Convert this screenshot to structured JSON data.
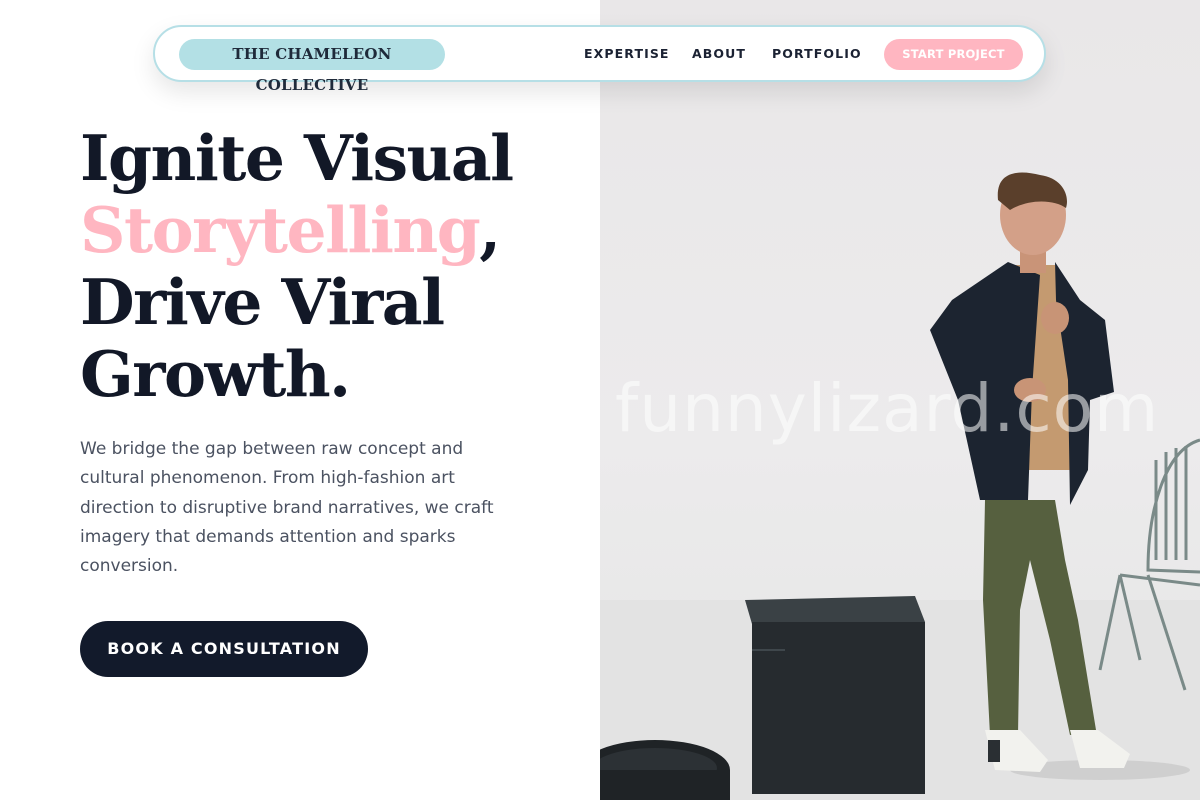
{
  "nav": {
    "brand": "THE CHAMELEON COLLECTIVE",
    "links": [
      "EXPERTISE",
      "ABOUT",
      "PORTFOLIO"
    ],
    "cta": "START PROJECT"
  },
  "hero": {
    "headline_line1": "Ignite Visual",
    "headline_accent": "Storytelling",
    "headline_comma": ",",
    "headline_line3": "Drive Viral",
    "headline_line4": "Growth.",
    "description": "We bridge the gap between raw concept and cultural phenomenon. From high-fashion art direction to disruptive brand narratives, we craft imagery that demands attention and sparks conversion.",
    "cta": "BOOK A CONSULTATION"
  },
  "watermark": "funnylizard.com",
  "colors": {
    "accent_pink": "#ffb6c1",
    "accent_teal": "#b3e0e5",
    "dark_navy": "#121a2b"
  }
}
